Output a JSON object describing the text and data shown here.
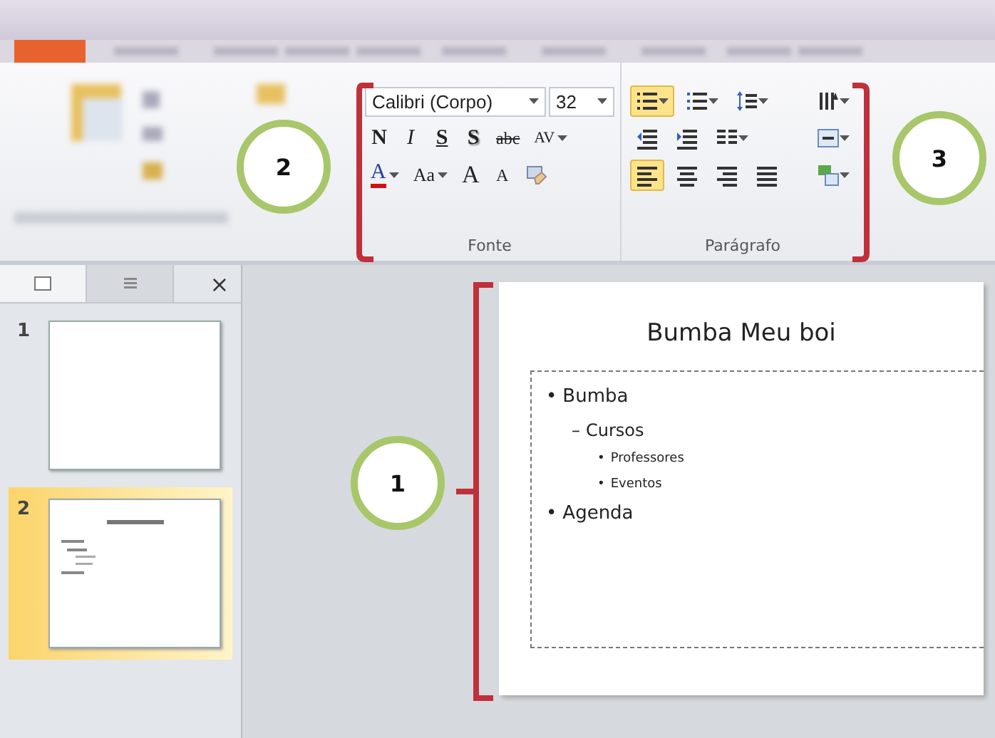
{
  "ribbon": {
    "font_group": {
      "font_name": "Calibri (Corpo)",
      "font_size": "32",
      "label": "Fonte",
      "buttons": [
        {
          "kind": "bold",
          "text": "N"
        },
        {
          "kind": "italic",
          "text": "I"
        },
        {
          "kind": "underline",
          "text": "S"
        },
        {
          "kind": "shadow",
          "text": "S"
        },
        {
          "kind": "strike",
          "text": "abc"
        },
        {
          "kind": "spacing",
          "text": "AV"
        },
        {
          "kind": "color",
          "text": "A"
        },
        {
          "kind": "case",
          "text": "Aa"
        },
        {
          "kind": "grow",
          "text": "A"
        },
        {
          "kind": "shrink",
          "text": "A"
        },
        {
          "kind": "clear"
        }
      ]
    },
    "paragraph_group": {
      "label": "Parágrafo",
      "rows": [
        [
          {
            "kind": "bullets",
            "selected": true
          },
          {
            "kind": "numbering",
            "selected": false
          },
          {
            "kind": "line-spacing",
            "selected": false
          },
          {
            "kind": "text-direction",
            "selected": false
          }
        ],
        [
          {
            "kind": "decrease-indent",
            "selected": false
          },
          {
            "kind": "increase-indent",
            "selected": false
          },
          {
            "kind": "columns",
            "selected": false
          },
          {
            "kind": "align-text",
            "selected": false
          }
        ],
        [
          {
            "kind": "align-left",
            "selected": true
          },
          {
            "kind": "align-center",
            "selected": false
          },
          {
            "kind": "align-right",
            "selected": false
          },
          {
            "kind": "justify",
            "selected": false
          },
          {
            "kind": "smartart",
            "selected": false
          }
        ]
      ]
    }
  },
  "slides_panel": {
    "tabs": [
      {
        "kind": "slides",
        "selected": true
      },
      {
        "kind": "outline",
        "selected": false
      }
    ],
    "close": "×",
    "thumbnails": [
      {
        "number": "1",
        "selected": false,
        "kind": "blank"
      },
      {
        "number": "2",
        "selected": true,
        "kind": "content"
      }
    ]
  },
  "slide": {
    "title": "Bumba Meu boi",
    "bullets": [
      {
        "marker": "•",
        "text": "Bumba",
        "children": [
          {
            "marker": "–",
            "text": "Cursos",
            "children": [
              {
                "marker": "•",
                "text": "Professores"
              },
              {
                "marker": "•",
                "text": "Eventos"
              }
            ]
          }
        ]
      },
      {
        "marker": "•",
        "text": "Agenda"
      }
    ]
  },
  "annotations": [
    {
      "label": "1"
    },
    {
      "label": "2"
    },
    {
      "label": "3"
    }
  ]
}
